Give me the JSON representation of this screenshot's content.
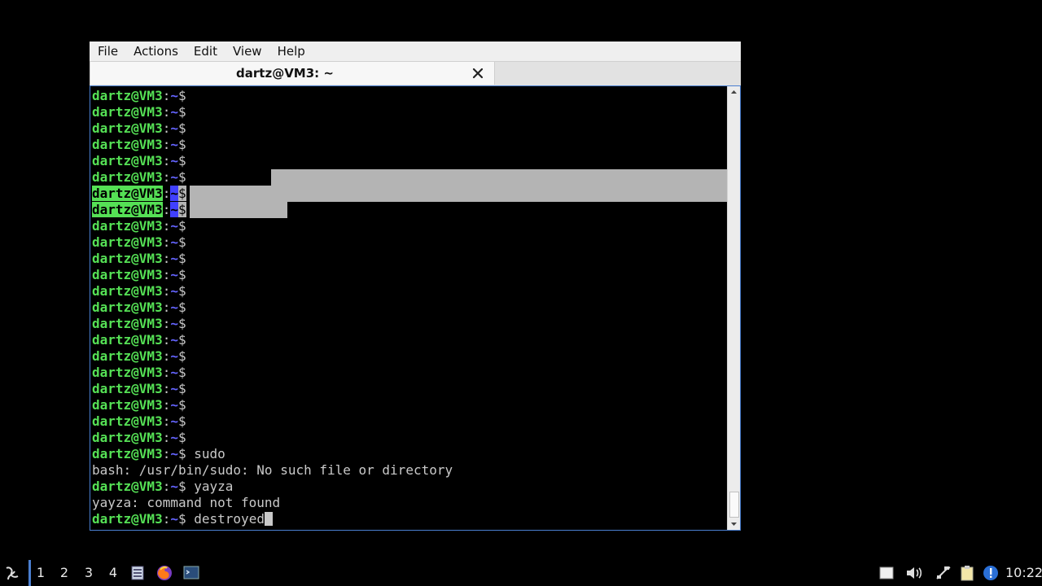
{
  "window": {
    "menu": [
      "File",
      "Actions",
      "Edit",
      "View",
      "Help"
    ],
    "tab_title": "dartz@VM3: ~"
  },
  "terminal": {
    "prompt_user": "dartz@VM3",
    "prompt_colon": ":",
    "prompt_path": "~",
    "prompt_dollar": "$",
    "lines": [
      {
        "type": "prompt",
        "cmd": ""
      },
      {
        "type": "prompt",
        "cmd": ""
      },
      {
        "type": "prompt",
        "cmd": ""
      },
      {
        "type": "prompt",
        "cmd": ""
      },
      {
        "type": "prompt",
        "cmd": ""
      },
      {
        "type": "prompt",
        "cmd": ""
      },
      {
        "type": "prompt",
        "cmd": "",
        "selected": true
      },
      {
        "type": "prompt",
        "cmd": "",
        "selected": true
      },
      {
        "type": "prompt",
        "cmd": ""
      },
      {
        "type": "prompt",
        "cmd": ""
      },
      {
        "type": "prompt",
        "cmd": ""
      },
      {
        "type": "prompt",
        "cmd": ""
      },
      {
        "type": "prompt",
        "cmd": ""
      },
      {
        "type": "prompt",
        "cmd": ""
      },
      {
        "type": "prompt",
        "cmd": ""
      },
      {
        "type": "prompt",
        "cmd": ""
      },
      {
        "type": "prompt",
        "cmd": ""
      },
      {
        "type": "prompt",
        "cmd": ""
      },
      {
        "type": "prompt",
        "cmd": ""
      },
      {
        "type": "prompt",
        "cmd": ""
      },
      {
        "type": "prompt",
        "cmd": ""
      },
      {
        "type": "prompt",
        "cmd": ""
      },
      {
        "type": "prompt",
        "cmd": " sudo"
      },
      {
        "type": "output",
        "text": "bash: /usr/bin/sudo: No such file or directory"
      },
      {
        "type": "prompt",
        "cmd": " yayza"
      },
      {
        "type": "output",
        "text": "yayza: command not found"
      },
      {
        "type": "prompt",
        "cmd": " destroyed",
        "cursor": true
      }
    ]
  },
  "panel": {
    "workspaces": [
      "1",
      "2",
      "3",
      "4"
    ],
    "clock": "10:22",
    "icons": [
      "start-menu-icon",
      "file-manager-icon",
      "firefox-icon",
      "terminal-icon",
      "window-icon",
      "volume-icon",
      "network-icon",
      "clipboard-icon",
      "update-icon"
    ]
  },
  "colors": {
    "prompt_user": "#55e055",
    "prompt_path": "#6464ff",
    "text": "#c9c9c9",
    "selection": "#b4b4b4",
    "accent": "#4a7fd0"
  }
}
